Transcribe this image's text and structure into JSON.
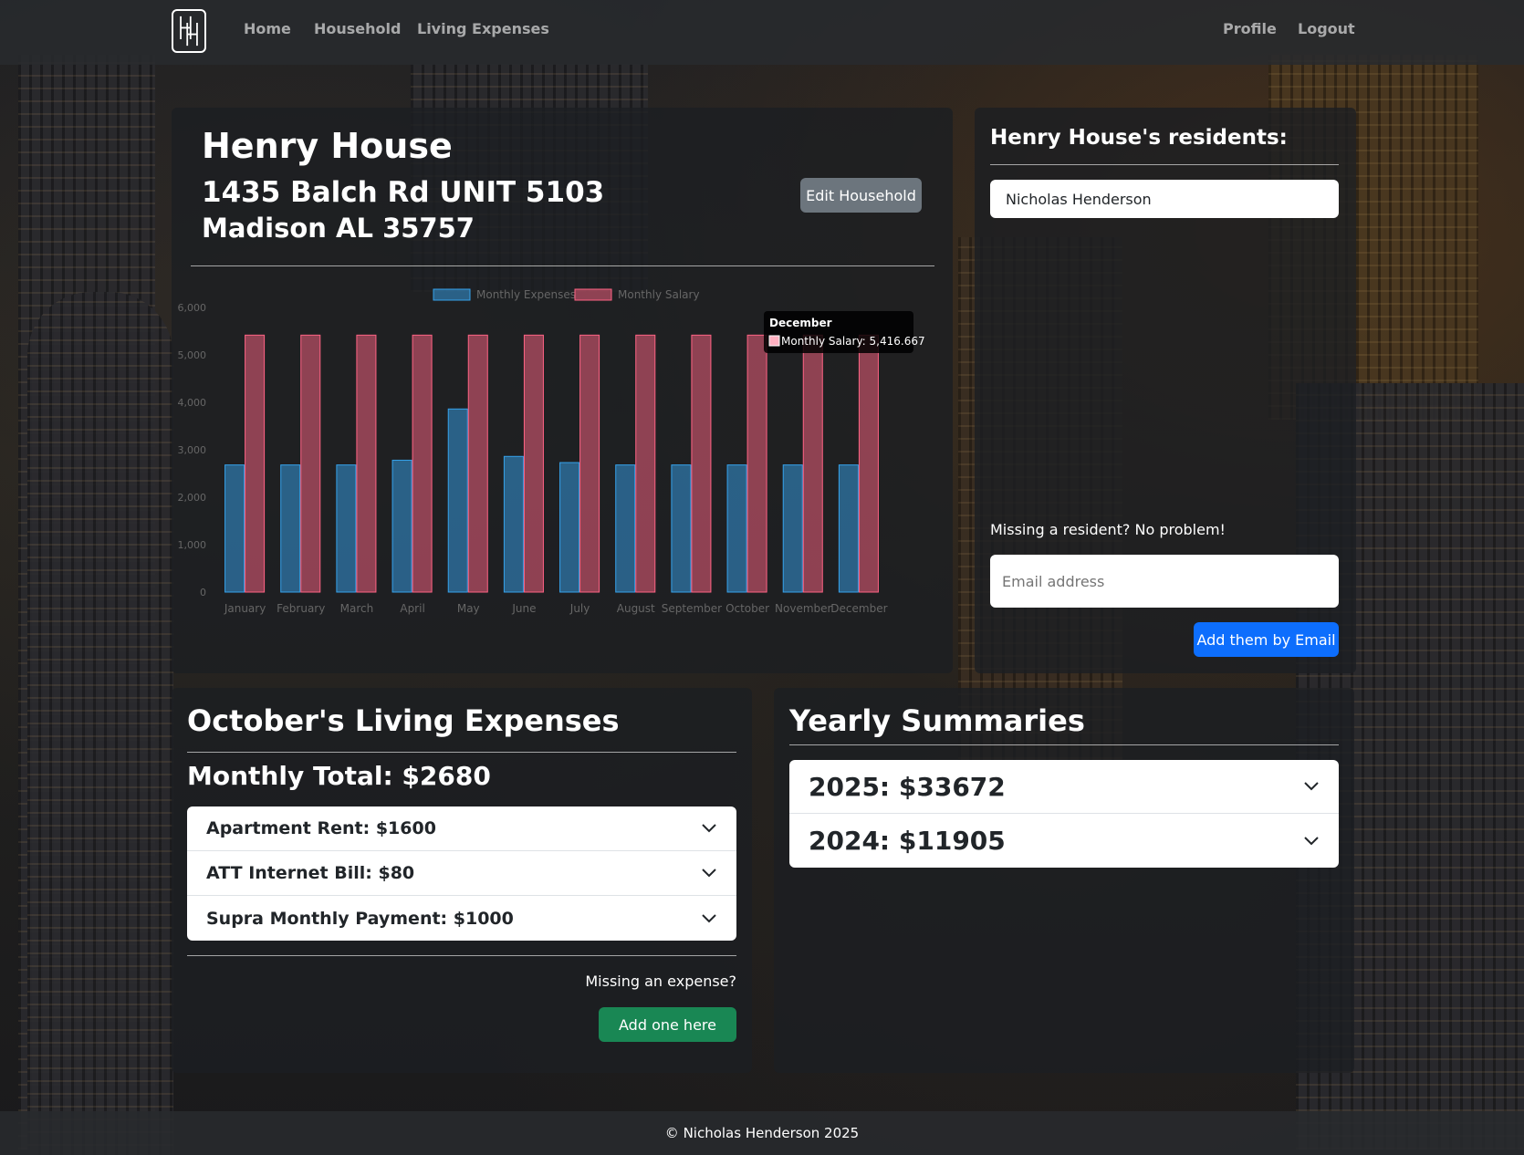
{
  "nav": {
    "home": "Home",
    "household": "Household",
    "living_expenses": "Living Expenses",
    "profile": "Profile",
    "logout": "Logout"
  },
  "household": {
    "name": "Henry House",
    "address_line1": "1435 Balch Rd UNIT 5103",
    "address_line2": "Madison AL 35757",
    "edit_button": "Edit Household"
  },
  "residents": {
    "title": "Henry House's residents:",
    "list": [
      "Nicholas Henderson"
    ],
    "missing_text": "Missing a resident? No problem!",
    "email_placeholder": "Email address",
    "add_button": "Add them by Email"
  },
  "expenses": {
    "title": "October's Living Expenses",
    "total": "Monthly Total: $2680",
    "items": [
      "Apartment Rent: $1600",
      "ATT Internet Bill: $80",
      "Supra Monthly Payment: $1000"
    ],
    "missing_text": "Missing an expense?",
    "add_button": "Add one here"
  },
  "summaries": {
    "title": "Yearly Summaries",
    "items": [
      "2025: $33672",
      "2024: $11905"
    ]
  },
  "footer": {
    "text": "© Nicholas Henderson 2025"
  },
  "chart_data": {
    "type": "bar",
    "categories": [
      "January",
      "February",
      "March",
      "April",
      "May",
      "June",
      "July",
      "August",
      "September",
      "October",
      "November",
      "December"
    ],
    "series": [
      {
        "name": "Monthly Expenses",
        "color": "#36a2eb",
        "values": [
          2680,
          2680,
          2680,
          2780,
          3860,
          2860,
          2730,
          2680,
          2680,
          2680,
          2680,
          2680
        ]
      },
      {
        "name": "Monthly Salary",
        "color": "#ff6384",
        "values": [
          5416.667,
          5416.667,
          5416.667,
          5416.667,
          5416.667,
          5416.667,
          5416.667,
          5416.667,
          5416.667,
          5416.667,
          5416.667,
          5416.667
        ]
      }
    ],
    "ylim": [
      0,
      6000
    ],
    "yticks": [
      "0",
      "1,000",
      "2,000",
      "3,000",
      "4,000",
      "5,000",
      "6,000"
    ],
    "legend": "top",
    "tooltip": {
      "title": "December",
      "label": "Monthly Salary: 5,416.667"
    }
  }
}
